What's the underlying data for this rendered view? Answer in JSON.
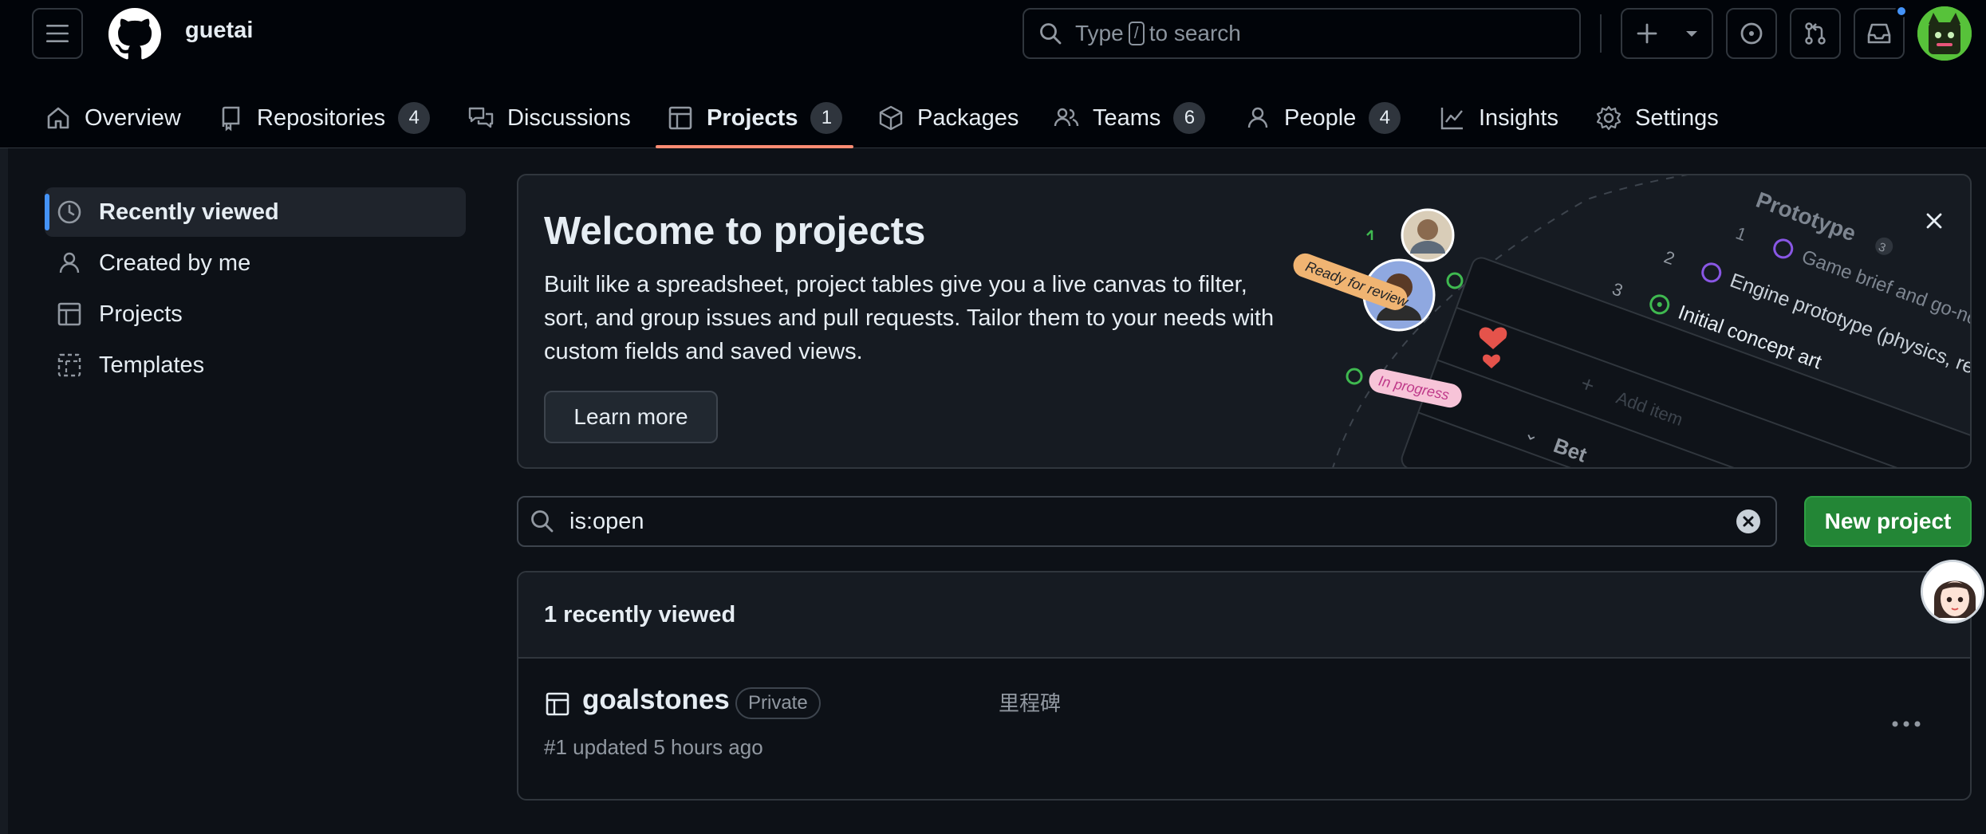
{
  "header": {
    "org_name": "guetai",
    "search_prefix": "Type",
    "search_key": "/",
    "search_suffix": "to search",
    "icons": [
      "menu-icon",
      "github-logo-icon",
      "search-icon",
      "plus-icon",
      "chevron-down-icon",
      "issue-icon",
      "pull-request-icon",
      "inbox-icon"
    ],
    "notification_color": "#4493f8"
  },
  "tabs": [
    {
      "label": "Overview",
      "icon": "home-icon"
    },
    {
      "label": "Repositories",
      "count": "4",
      "icon": "repo-icon"
    },
    {
      "label": "Discussions",
      "icon": "discussions-icon"
    },
    {
      "label": "Projects",
      "count": "1",
      "icon": "table-icon",
      "active": true
    },
    {
      "label": "Packages",
      "icon": "package-icon"
    },
    {
      "label": "Teams",
      "count": "6",
      "icon": "people-icon"
    },
    {
      "label": "People",
      "count": "4",
      "icon": "person-icon"
    },
    {
      "label": "Insights",
      "icon": "graph-icon"
    },
    {
      "label": "Settings",
      "icon": "gear-icon"
    }
  ],
  "sidebar": {
    "items": [
      {
        "label": "Recently viewed",
        "icon": "clock-icon",
        "active": true
      },
      {
        "label": "Created by me",
        "icon": "person-icon"
      },
      {
        "label": "Projects",
        "icon": "table-icon"
      },
      {
        "label": "Templates",
        "icon": "template-icon"
      }
    ]
  },
  "banner": {
    "title": "Welcome to projects",
    "text": "Built like a spreadsheet, project tables give you a live canvas to filter, sort, and group issues and pull requests. Tailor them to your needs with custom fields and saved views.",
    "learn_more": "Learn more",
    "illustration": {
      "ready_label": "Ready for review",
      "progress_label": "In progress",
      "rows": [
        {
          "num": "1",
          "text": "Game brief and go-no-"
        },
        {
          "num": "2",
          "text": "Engine prototype (physics, renderin"
        },
        {
          "num": "3",
          "text": "Initial concept art"
        }
      ],
      "group_title": "Prototype",
      "group_count": "3",
      "add_item": "Add item",
      "next_group": "Bet"
    }
  },
  "filter": {
    "value": "is:open",
    "new_project": "New project"
  },
  "list": {
    "heading": "1 recently viewed",
    "items": [
      {
        "name": "goalstones",
        "visibility": "Private",
        "description": "里程碑",
        "meta": "#1 updated 5 hours ago"
      }
    ]
  },
  "colors": {
    "accent_underline": "#fd8c73",
    "primary_button": "#238636",
    "active_marker": "#4493f8"
  }
}
